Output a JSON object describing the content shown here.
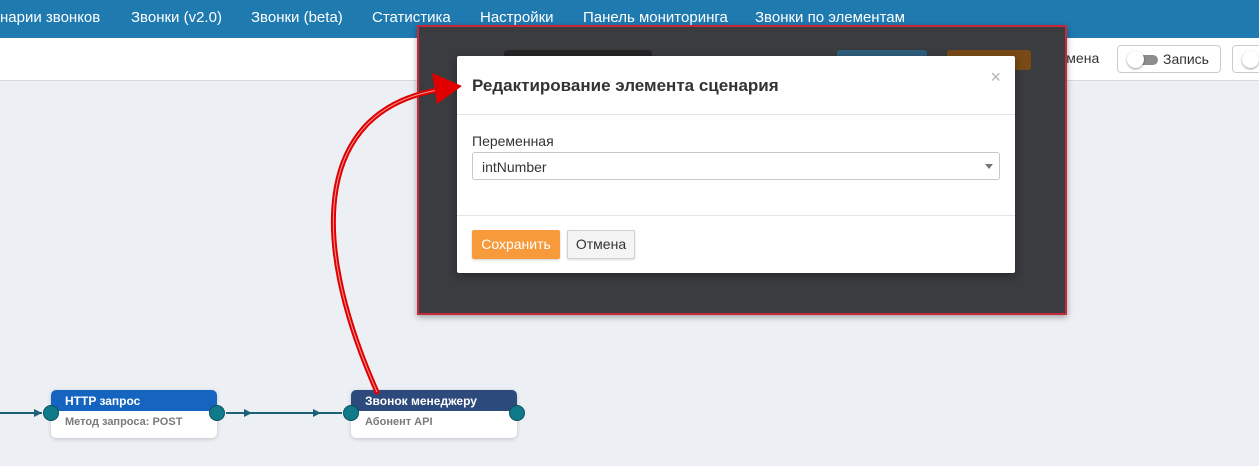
{
  "topnav": {
    "items": [
      "нарии звонков",
      "Звонки (v2.0)",
      "Звонки (beta)",
      "Статистика",
      "Настройки",
      "Панель мониторинга",
      "Звонки по элементам"
    ]
  },
  "toolbar": {
    "cancel_label": "Отмена",
    "record_label": "Запись"
  },
  "modal": {
    "title": "Редактирование элемента сценария",
    "close_glyph": "×",
    "field_label": "Переменная",
    "field_value": "intNumber",
    "save_label": "Сохранить",
    "cancel_label": "Отмена"
  },
  "nodes": [
    {
      "title": "HTTP запрос",
      "subtitle": "Метод запроса: POST",
      "color": "#1565c0"
    },
    {
      "title": "Звонок менеджеру",
      "subtitle": "Абонент API",
      "color": "#2d4a7c"
    }
  ],
  "colors": {
    "nav": "#1f7ab0",
    "accent_orange": "#f79a3b",
    "highlight_border": "#c8283c",
    "connector": "#1d6077",
    "arrow": "#e00000"
  }
}
